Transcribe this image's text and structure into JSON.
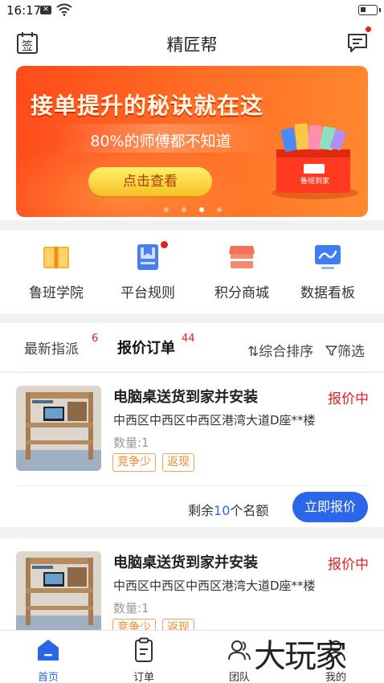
{
  "status_bar": {
    "time": "16:17"
  },
  "header": {
    "title": "精匠帮",
    "sign_label": "签"
  },
  "banner": {
    "headline": "接单提升的秘诀就在这",
    "subtitle": "80%的师傅都不知道",
    "cta": "点击查看",
    "gift_brand": "鲁班到家",
    "page_count": 4,
    "active_page": 3
  },
  "menu": [
    {
      "label": "鲁班学院",
      "icon": "book-icon",
      "color": "#f5b12b"
    },
    {
      "label": "平台规则",
      "icon": "rules-doc-icon",
      "color": "#4a7ef0",
      "has_badge": true
    },
    {
      "label": "积分商城",
      "icon": "shop-icon",
      "color": "#f06a4a"
    },
    {
      "label": "数据看板",
      "icon": "data-board-icon",
      "color": "#3f7cf5"
    }
  ],
  "tabs": {
    "latest": {
      "label": "最新指派",
      "count": "6"
    },
    "quotes": {
      "label": "报价订单",
      "count": "44"
    },
    "sort": "综合排序",
    "filter": "筛选"
  },
  "orders": [
    {
      "title": "电脑桌送货到家并安装",
      "status": "报价中",
      "address": "中西区中西区中西区港湾大道D座**楼",
      "quantity": "数量:1",
      "tags": [
        "竞争少",
        "返现"
      ],
      "remain_prefix": "剩余",
      "remain_count": "10",
      "remain_suffix": "个名额",
      "button": "立即报价"
    },
    {
      "title": "电脑桌送货到家并安装",
      "status": "报价中",
      "address": "中西区中西区中西区港湾大道D座**楼",
      "quantity": "数量:1",
      "tags": [
        "竞争少",
        "返现"
      ]
    }
  ],
  "bottom_nav": [
    {
      "label": "首页",
      "icon": "home-icon",
      "active": true
    },
    {
      "label": "订单",
      "icon": "order-icon"
    },
    {
      "label": "团队",
      "icon": "team-icon"
    },
    {
      "label": "我的",
      "icon": "profile-icon"
    }
  ],
  "watermark": "大玩家",
  "colors": {
    "primary": "#2c66e8",
    "alert": "#e5201d",
    "tag": "#f08a2a",
    "banner": "#ff5a20"
  }
}
